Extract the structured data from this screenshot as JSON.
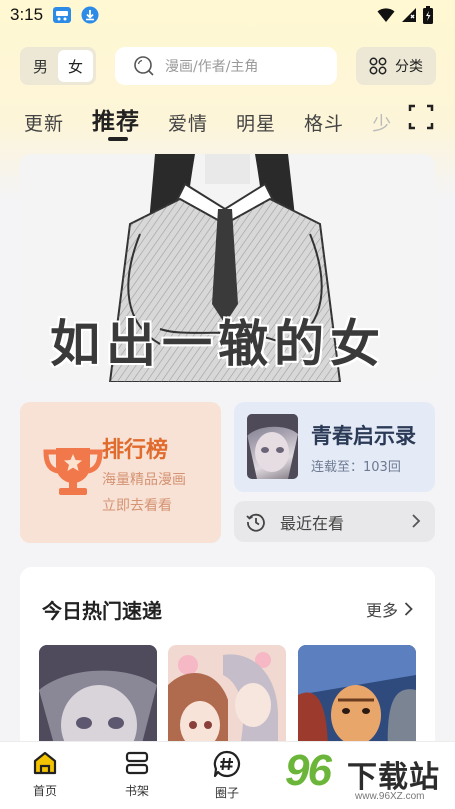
{
  "status_bar": {
    "time": "3:15"
  },
  "header": {
    "gender_options": [
      "男",
      "女"
    ],
    "gender_active": "女",
    "search_placeholder": "漫画/作者/主角",
    "category_label": "分类"
  },
  "tabs": [
    {
      "label": "更新",
      "active": false
    },
    {
      "label": "推荐",
      "active": true
    },
    {
      "label": "爱情",
      "active": false
    },
    {
      "label": "明星",
      "active": false
    },
    {
      "label": "格斗",
      "active": false
    },
    {
      "label": "少",
      "active": false
    }
  ],
  "banner": {
    "title": "如出一辙的女儿"
  },
  "ranking": {
    "title": "排行榜",
    "line1": "海量精品漫画",
    "line2": "立即去看看"
  },
  "continue_reading": {
    "title": "青春启示录",
    "progress": "连载至：103回"
  },
  "recent": {
    "label": "最近在看"
  },
  "hot": {
    "title": "今日热门速递",
    "more": "更多"
  },
  "bottom_nav": [
    {
      "label": "首页",
      "active": true
    },
    {
      "label": "书架",
      "active": false
    },
    {
      "label": "圈子",
      "active": false
    }
  ],
  "watermark": {
    "brand": "96",
    "text": "下载站",
    "url": "www.96XZ.com"
  },
  "colors": {
    "accent_orange": "#e16a2d",
    "home_yellow": "#f4c400"
  }
}
